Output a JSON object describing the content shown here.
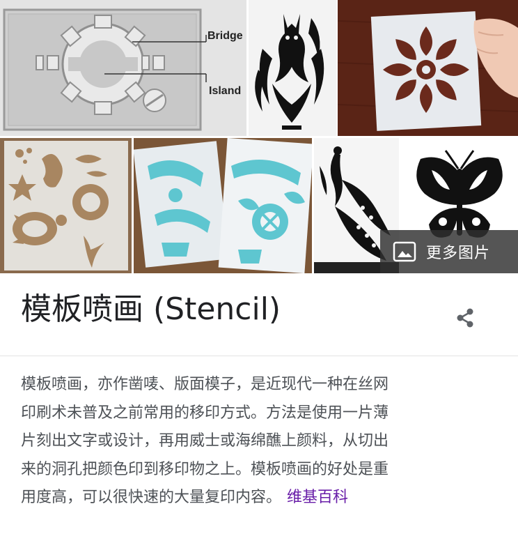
{
  "gallery": {
    "diagram": {
      "label_bridge": "Bridge",
      "label_island": "Island"
    },
    "more_images_label": "更多图片"
  },
  "title": "模板喷画 (Stencil)",
  "description": {
    "lines": [
      "模板喷画，亦作凿唛、版面模子，是近现代一种在丝网",
      "印刷术未普及之前常用的移印方式。方法是使用一片薄",
      "片刻出文字或设计，再用威士或海绵醮上颜料，从切出",
      "来的洞孔把颜色印到移印物之上。模板喷画的好处是重",
      "用度高，可以很快速的大量复印内容。"
    ],
    "source_link": "维基百科"
  },
  "icons": {
    "share": "share-icon",
    "more_images": "image-icon"
  },
  "colors": {
    "title": "#202124",
    "body_text": "#4d5156",
    "link": "#681da8",
    "overlay": "#303030"
  }
}
